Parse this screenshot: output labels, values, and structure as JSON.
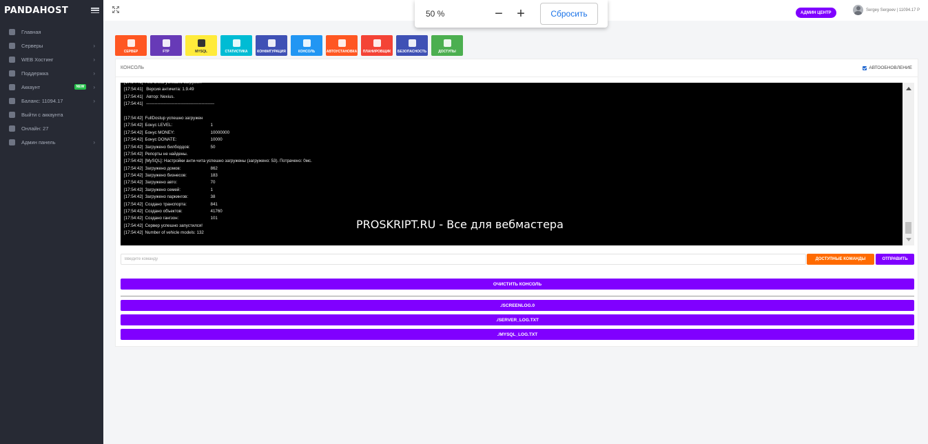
{
  "brand": {
    "logo": "PANDAHOST"
  },
  "sidebar": {
    "items": [
      {
        "label": "Главная",
        "icon": "home-icon",
        "chevron": ""
      },
      {
        "label": "Серверы",
        "icon": "servers-icon",
        "chevron": "›"
      },
      {
        "label": "WEB Хостинг",
        "icon": "cloud-icon",
        "chevron": "›"
      },
      {
        "label": "Поддержка",
        "icon": "support-icon",
        "chevron": "›"
      },
      {
        "label": "Аккаунт",
        "icon": "gear-icon",
        "chevron": "›",
        "badge": "NEW"
      },
      {
        "label": "Баланс: 11094.17",
        "icon": "wallet-icon",
        "chevron": "›"
      },
      {
        "label": "Выйти с аккаунта",
        "icon": "logout-icon",
        "chevron": ""
      },
      {
        "label": "Онлайн: 27",
        "icon": "users-icon",
        "chevron": ""
      },
      {
        "label": "Админ панель",
        "icon": "globe-icon",
        "chevron": "›"
      }
    ]
  },
  "topbar": {
    "admin_label": "АДМИН ЦЕНТР",
    "user_label": "Sergey Sergeev | 11094.17 Р"
  },
  "zoom": {
    "level": "50 %",
    "minus": "−",
    "plus": "+",
    "reset_label": "Сбросить"
  },
  "tiles": [
    {
      "label": "СЕРВЕР",
      "color": "#ff5722",
      "icon": "monitor-icon"
    },
    {
      "label": "FTP",
      "color": "#673ab7",
      "icon": "file-icon"
    },
    {
      "label": "MYSQL",
      "color": "#ffeb3b",
      "icon": "database-icon",
      "text_color": "#333333"
    },
    {
      "label": "СТАТИСТИКА",
      "color": "#00bcd4",
      "icon": "bar-chart-icon"
    },
    {
      "label": "КОНФИГУРАЦИЯ",
      "color": "#3f51b5",
      "icon": "config-file-icon"
    },
    {
      "label": "КОНСОЛЬ",
      "color": "#2196f3",
      "icon": "console-icon"
    },
    {
      "label": "АВТОУСТАНОВКА",
      "color": "#ff5722",
      "icon": "install-icon"
    },
    {
      "label": "ПЛАНИРОВЩИК",
      "color": "#f44336",
      "icon": "calendar-icon"
    },
    {
      "label": "БЕЗОПАСНОСТЬ",
      "color": "#3f51b5",
      "icon": "shield-icon"
    },
    {
      "label": "ДОСТУПЫ",
      "color": "#4caf50",
      "icon": "access-icon"
    }
  ],
  "console_card": {
    "title": "КОНСОЛЬ",
    "autoupdate_label": "АВТООБНОВЛЕНИЕ",
    "lines": [
      {
        "time": "[17:54:41]",
        "text": "Anti-cheat успешно загружен",
        "val": ""
      },
      {
        "time": "[17:54:41]",
        "text": " Версия античита: 1.9.49",
        "val": ""
      },
      {
        "time": "[17:54:41]",
        "text": " Автор: Nexius.",
        "val": ""
      },
      {
        "time": "[17:54:41]",
        "text": " ------------------------------------------------",
        "val": ""
      },
      {
        "time": "",
        "text": "",
        "val": ""
      },
      {
        "time": "[17:54:42]",
        "text": "FullDostup успешно загружен",
        "val": ""
      },
      {
        "time": "[17:54:42]",
        "text": "Бонус LEVEL:",
        "val": "1"
      },
      {
        "time": "[17:54:42]",
        "text": "Бонус MONEY:",
        "val": "10000000"
      },
      {
        "time": "[17:54:42]",
        "text": "Бонус DONATE:",
        "val": "10000"
      },
      {
        "time": "[17:54:42]",
        "text": "Загружено билбордов:",
        "val": "50"
      },
      {
        "time": "[17:54:42]",
        "text": "Репорты не найдены.",
        "val": ""
      },
      {
        "time": "[17:54:42]",
        "text": "[MySQL]: Настройки анти-чита успешно загружены (загружено: 53). Потрачено: 0мс.",
        "val": ""
      },
      {
        "time": "[17:54:42]",
        "text": "Загружено домов:",
        "val": "862"
      },
      {
        "time": "[17:54:42]",
        "text": "Загружено бизнесов:",
        "val": "183"
      },
      {
        "time": "[17:54:42]",
        "text": "Загружено авто:",
        "val": "70"
      },
      {
        "time": "[17:54:42]",
        "text": "Загружено семей:",
        "val": "1"
      },
      {
        "time": "[17:54:42]",
        "text": "Загружено паркингов:",
        "val": "38"
      },
      {
        "time": "[17:54:42]",
        "text": "Создано транспорта:",
        "val": "841"
      },
      {
        "time": "[17:54:42]",
        "text": "Создано объектов:",
        "val": "41760"
      },
      {
        "time": "[17:54:42]",
        "text": "Создано гангзон:",
        "val": "101"
      },
      {
        "time": "[17:54:42]",
        "text": "Сервер успешно запустился!",
        "val": ""
      },
      {
        "time": "[17:54:42]",
        "text": "Number of vehicle models: 132",
        "val": ""
      }
    ],
    "watermark": "PROSKRIPT.RU - Все для вебмастера",
    "command_placeholder": "Введите команду",
    "available_commands_label": "ДОСТУПНЫЕ КОМАНДЫ",
    "send_label": "ОТПРАВИТЬ",
    "clear_label": "ОЧИСТИТЬ КОНСОЛЬ",
    "log_buttons": [
      "./SCREENLOG.0",
      "./SERVER_LOG.TXT",
      "./MYSQL_LOG.TXT"
    ]
  }
}
